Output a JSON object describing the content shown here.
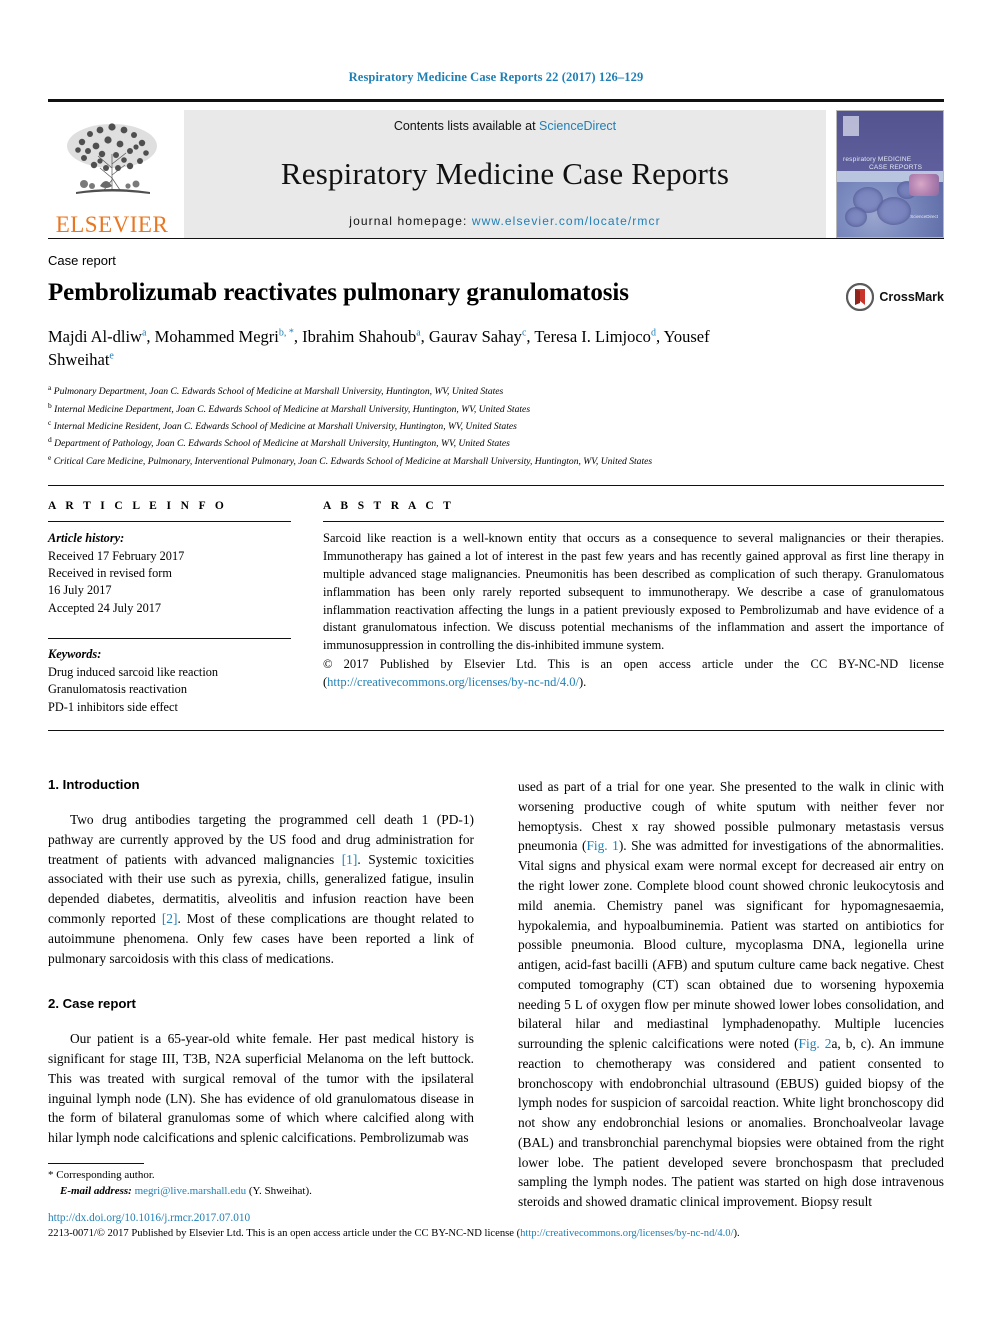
{
  "running_head": "Respiratory Medicine Case Reports 22 (2017) 126–129",
  "masthead": {
    "contents_prefix": "Contents lists available at ",
    "sciencedirect": "ScienceDirect",
    "journal_title": "Respiratory Medicine Case Reports",
    "homepage_prefix": "journal homepage: ",
    "homepage_url": "www.elsevier.com/locate/rmcr",
    "publisher_wordmark": "ELSEVIER",
    "cover_title_line1": "respiratory MEDICINE",
    "cover_title_line2": "CASE REPORTS",
    "cover_footer": "ScienceDirect"
  },
  "article": {
    "kind": "Case report",
    "title": "Pembrolizumab reactivates pulmonary granulomatosis",
    "crossmark_label": "CrossMark",
    "authors": [
      {
        "name": "Majdi Al-dliw",
        "sup": "a",
        "star": false,
        "sep": ", "
      },
      {
        "name": "Mohammed Megri",
        "sup": "b",
        "star": true,
        "sep": ", "
      },
      {
        "name": "Ibrahim Shahoub",
        "sup": "a",
        "star": false,
        "sep": ", "
      },
      {
        "name": "Gaurav Sahay",
        "sup": "c",
        "star": false,
        "sep": ", "
      },
      {
        "name": "Teresa I. Limjoco",
        "sup": "d",
        "star": false,
        "sep": ", "
      },
      {
        "name": "Yousef Shweihat",
        "sup": "e",
        "star": false,
        "sep": ""
      }
    ],
    "affiliations": [
      {
        "sup": "a",
        "text": "Pulmonary Department, Joan C. Edwards School of Medicine at Marshall University, Huntington, WV, United States"
      },
      {
        "sup": "b",
        "text": "Internal Medicine Department, Joan C. Edwards School of Medicine at Marshall University, Huntington, WV, United States"
      },
      {
        "sup": "c",
        "text": "Internal Medicine Resident, Joan C. Edwards School of Medicine at Marshall University, Huntington, WV, United States"
      },
      {
        "sup": "d",
        "text": "Department of Pathology, Joan C. Edwards School of Medicine at Marshall University, Huntington, WV, United States"
      },
      {
        "sup": "e",
        "text": "Critical Care Medicine, Pulmonary, Interventional Pulmonary, Joan C. Edwards School of Medicine at Marshall University, Huntington, WV, United States"
      }
    ]
  },
  "article_info": {
    "heading": "A R T I C L E  I N F O",
    "history_label": "Article history:",
    "history": [
      "Received 17 February 2017",
      "Received in revised form",
      "16 July 2017",
      "Accepted 24 July 2017"
    ],
    "keywords_label": "Keywords:",
    "keywords": [
      "Drug induced sarcoid like reaction",
      "Granulomatosis reactivation",
      "PD-1 inhibitors side effect"
    ]
  },
  "abstract": {
    "heading": "A B S T R A C T",
    "body": "Sarcoid like reaction is a well-known entity that occurs as a consequence to several malignancies or their therapies. Immunotherapy has gained a lot of interest in the past few years and has recently gained approval as first line therapy in multiple advanced stage malignancies. Pneumonitis has been described as complication of such therapy. Granulomatous inflammation has been only rarely reported subsequent to immunotherapy. We describe a case of granulomatous inflammation reactivation affecting the lungs in a patient previously exposed to Pembrolizumab and have evidence of a distant granulomatous infection. We discuss potential mechanisms of the inflammation and assert the importance of immunosuppression in controlling the dis-inhibited immune system.",
    "copyright_prefix": "© 2017 Published by Elsevier Ltd. This is an open access article under the CC BY-NC-ND license (",
    "copyright_link": "http://creativecommons.org/licenses/by-nc-nd/4.0/",
    "copyright_suffix": ")."
  },
  "body": {
    "left": {
      "section1_title": "1. Introduction",
      "para1_a": "Two drug antibodies targeting the programmed cell death 1 (PD-1) pathway are currently approved by the US food and drug administration for treatment of patients with advanced malignancies ",
      "ref1": "[1]",
      "para1_b": ". Systemic toxicities associated with their use such as pyrexia, chills, generalized fatigue, insulin depended diabetes, dermatitis, alveolitis and infusion reaction have been commonly reported ",
      "ref2": "[2]",
      "para1_c": ". Most of these complications are thought related to autoimmune phenomena. Only few cases have been reported a link of pulmonary sarcoidosis with this class of medications.",
      "section2_title": "2. Case report",
      "para2": "Our patient is a 65-year-old white female. Her past medical history is significant for stage III, T3B, N2A superficial Melanoma on the left buttock. This was treated with surgical removal of the tumor with the ipsilateral inguinal lymph node (LN). She has evidence of old granulomatous disease in the form of bilateral granulomas some of which where calcified along with hilar lymph node calcifications and splenic calcifications. Pembrolizumab was"
    },
    "right": {
      "para_a": "used as part of a trial for one year. She presented to the walk in clinic with worsening productive cough of white sputum with neither fever nor hemoptysis. Chest x ray showed possible pulmonary metastasis versus pneumonia (",
      "fig1": "Fig. 1",
      "para_b": "). She was admitted for investigations of the abnormalities. Vital signs and physical exam were normal except for decreased air entry on the right lower zone. Complete blood count showed chronic leukocytosis and mild anemia. Chemistry panel was significant for hypomagnesaemia, hypokalemia, and hypoalbuminemia. Patient was started on antibiotics for possible pneumonia. Blood culture, mycoplasma DNA, legionella urine antigen, acid-fast bacilli (AFB) and sputum culture came back negative. Chest computed tomography (CT) scan obtained due to worsening hypoxemia needing 5 L of oxygen flow per minute showed lower lobes consolidation, and bilateral hilar and mediastinal lymphadenopathy. Multiple lucencies surrounding the splenic calcifications were noted (",
      "fig2": "Fig. 2",
      "para_c": "a, b, c). An immune reaction to chemotherapy was considered and patient consented to bronchoscopy with endobronchial ultrasound (EBUS) guided biopsy of the lymph nodes for suspicion of sarcoidal reaction. White light bronchoscopy did not show any endobronchial lesions or anomalies. Bronchoalveolar lavage (BAL) and transbronchial parenchymal biopsies were obtained from the right lower lobe. The patient developed severe bronchospasm that precluded sampling the lymph nodes. The patient was started on high dose intravenous steroids and showed dramatic clinical improvement. Biopsy result"
    }
  },
  "footnote": {
    "corresponding": "* Corresponding author.",
    "email_label": "E-mail address:",
    "email": "megri@live.marshall.edu",
    "email_suffix": "(Y. Shweihat)."
  },
  "footer": {
    "doi": "http://dx.doi.org/10.1016/j.rmcr.2017.07.010",
    "issn_prefix": "2213-0071/© 2017 Published by Elsevier Ltd. This is an open access article under the CC BY-NC-ND license (",
    "license_url": "http://creativecommons.org/licenses/by-nc-nd/4.0/",
    "issn_suffix": ")."
  },
  "colors": {
    "link": "#1f7fb5",
    "elsevier_orange": "#E87722",
    "masthead_gray": "#e9e9e9"
  }
}
